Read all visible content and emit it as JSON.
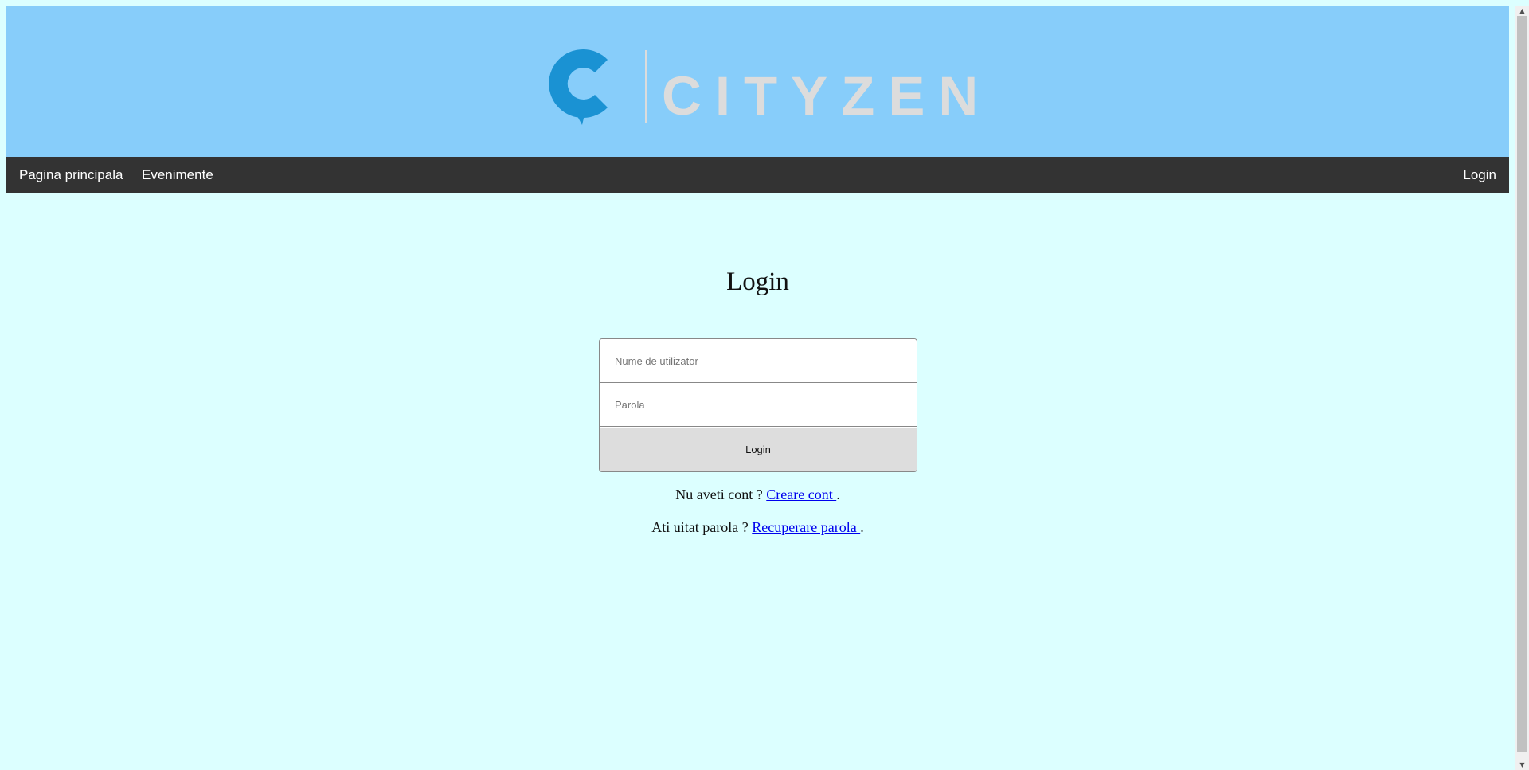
{
  "header": {
    "logo_text": "CITYZEN",
    "logo_color": "#1a92d3",
    "logo_text_color": "#dcdcdc",
    "background": "#87cdfa"
  },
  "nav": {
    "home_label": "Pagina principala",
    "events_label": "Evenimente",
    "login_label": "Login"
  },
  "login": {
    "title": "Login",
    "username_placeholder": "Nume de utilizator",
    "password_placeholder": "Parola",
    "button_label": "Login"
  },
  "footer_links": {
    "no_account_text": "Nu aveti cont ? ",
    "create_account_link": "Creare cont ",
    "forgot_password_text": "Ati uitat parola ? ",
    "recover_password_link": "Recuperare parola ",
    "period": "."
  }
}
